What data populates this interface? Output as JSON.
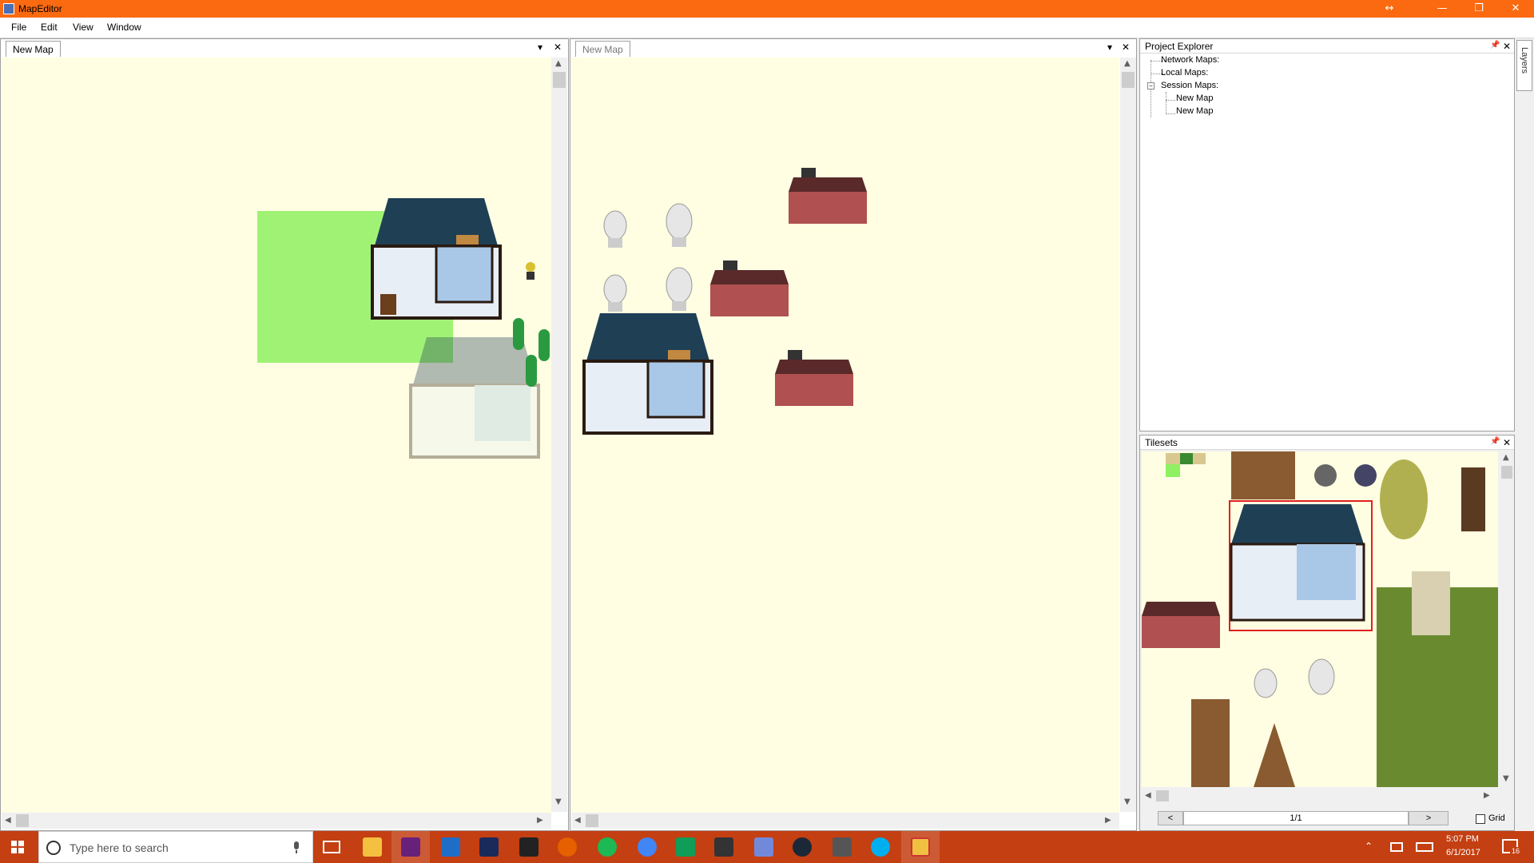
{
  "window": {
    "title": "MapEditor",
    "controls": {
      "resize": "↔",
      "minimize": "—",
      "maximize": "❐",
      "close": "✕"
    }
  },
  "menu": [
    "File",
    "Edit",
    "View",
    "Window"
  ],
  "left_doc": {
    "tab_label": "New Map",
    "dropdown": "▾",
    "close": "✕"
  },
  "right_doc": {
    "tab_label": "New Map",
    "dropdown": "▾",
    "close": "✕"
  },
  "project_explorer": {
    "title": "Project Explorer",
    "pin": "📌",
    "close": "✕",
    "tree": {
      "network_maps": "Network Maps:",
      "local_maps": "Local Maps:",
      "session_maps": "Session Maps:",
      "expander": "−",
      "session_children": [
        "New Map",
        "New Map"
      ]
    }
  },
  "tilesets": {
    "title": "Tilesets",
    "pin": "📌",
    "close": "✕",
    "page": "1/1",
    "prev": "<",
    "next": ">",
    "grid_label": "Grid",
    "grid_checked": false
  },
  "layers_tab": {
    "label": "Layers"
  },
  "scroll": {
    "up": "▲",
    "down": "▼",
    "left": "◀",
    "right": "▶"
  },
  "taskbar": {
    "search_placeholder": "Type here to search",
    "clock_time": "5:07 PM",
    "clock_date": "6/1/2017",
    "notification_count": "16",
    "apps": [
      "file-explorer",
      "visual-studio",
      "vs-code",
      "terminal",
      "kindle",
      "firefox",
      "spotify",
      "chrome",
      "hangouts",
      "x-app",
      "discord",
      "steam",
      "misc-app",
      "skype",
      "map-editor"
    ]
  },
  "colors": {
    "titlebar": "#fb6a10",
    "canvas_bg": "#fffee2",
    "selection_green": "#8ff062",
    "selection_red": "#e02020",
    "taskbar": "#c43f12"
  }
}
